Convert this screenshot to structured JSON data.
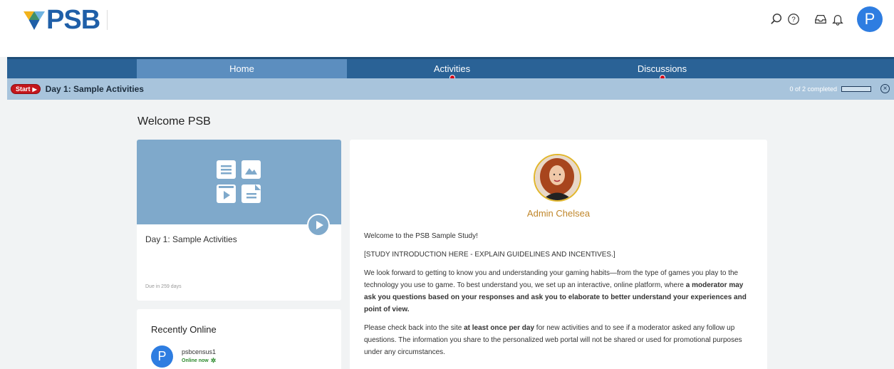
{
  "header": {
    "logo_text": "PSB",
    "icons": [
      "search-icon",
      "help-icon",
      "inbox-icon",
      "bell-icon"
    ],
    "avatar_initial": "P"
  },
  "nav": {
    "tabs": [
      {
        "label": "Home",
        "active": true,
        "has_dot": false
      },
      {
        "label": "Activities",
        "active": false,
        "has_dot": true
      },
      {
        "label": "Discussions",
        "active": false,
        "has_dot": true
      }
    ]
  },
  "activity_bar": {
    "start_label": "Start",
    "title": "Day 1: Sample Activities",
    "progress_text": "0 of 2 completed",
    "progress_fraction": 0
  },
  "main": {
    "welcome_title": "Welcome PSB",
    "activity_card": {
      "title": "Day 1: Sample Activities",
      "due": "Due in 259 days"
    },
    "recent": {
      "title": "Recently Online",
      "user_initial": "P",
      "user_name": "psbcensus1",
      "status": "Online now"
    },
    "intro": {
      "admin_name": "Admin Chelsea",
      "p1": "Welcome to the PSB Sample Study!",
      "p2": "[STUDY INTRODUCTION HERE - EXPLAIN GUIDELINES AND INCENTIVES.]",
      "p3_a": "We look forward to getting to know you and understanding your gaming habits—from the type of games you play to the technology you use to game. To best understand you, we set up an interactive, online platform, where ",
      "p3_b": "a moderator may ask you questions based on your responses and ask you to elaborate to better understand your experiences and point of view.",
      "p4_a": "Please check back into the site ",
      "p4_b": "at least once per day",
      "p4_c": " for new activities and to see if a moderator asked any follow up questions. The information you share to the personalized web portal will not be shared or used for promotional purposes under any circumstances."
    }
  },
  "colors": {
    "nav_bg": "#2a6296",
    "nav_active": "#5c8ebf",
    "activity_bar": "#a8c4dc",
    "media_bg": "#7fa9cb",
    "start_badge": "#c4161c",
    "avatar": "#2e7de1",
    "admin_name": "#c0862a",
    "online": "#2e8b2e"
  }
}
